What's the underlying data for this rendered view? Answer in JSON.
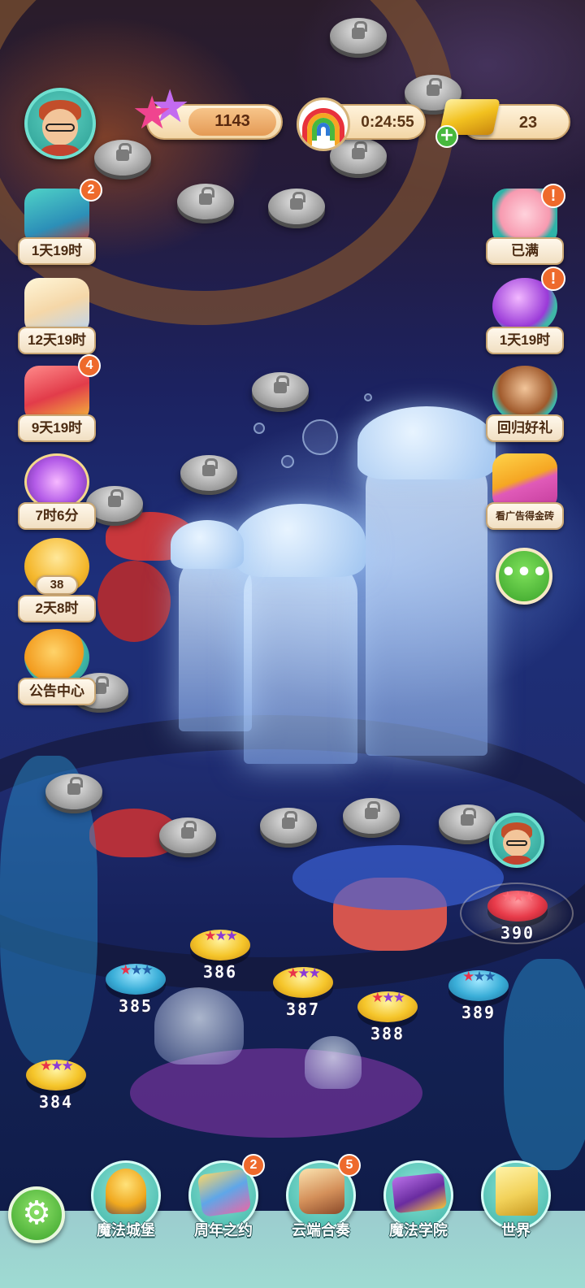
{
  "hud": {
    "stars": "1143",
    "timer": "0:24:55",
    "gold": "23",
    "gold_add_symbol": "+"
  },
  "left_events": [
    {
      "label": "1天19时",
      "badge": "2",
      "icon": "toy-train-icon"
    },
    {
      "label": "12天19时",
      "icon": "bow-dress-icon"
    },
    {
      "label": "9天19时",
      "badge": "4",
      "icon": "treasure-chest-icon"
    },
    {
      "label": "7时6分",
      "icon": "purple-star-icon"
    },
    {
      "label": "2天8时",
      "sub": "38",
      "icon": "paw-icon"
    },
    {
      "label": "公告中心",
      "icon": "megaphone-icon"
    }
  ],
  "right_events": [
    {
      "label": "已满",
      "badge": "!",
      "icon": "piggy-bank-icon"
    },
    {
      "label": "1天19时",
      "badge": "!",
      "icon": "crystal-ball-icon"
    },
    {
      "label": "回归好礼",
      "icon": "winking-boy-icon"
    },
    {
      "label": "看广告得金砖",
      "icon": "video-ad-icon"
    }
  ],
  "more_button": "•••",
  "levels": [
    {
      "num": "384",
      "type": "gold",
      "stars": [
        "red",
        "purple",
        "purple"
      ]
    },
    {
      "num": "385",
      "type": "blue",
      "stars": [
        "red",
        "blue",
        "blue"
      ]
    },
    {
      "num": "386",
      "type": "gold",
      "stars": [
        "red",
        "purple",
        "purple"
      ]
    },
    {
      "num": "387",
      "type": "gold",
      "stars": [
        "red",
        "purple",
        "purple"
      ]
    },
    {
      "num": "388",
      "type": "gold",
      "stars": [
        "red",
        "purple",
        "purple"
      ]
    },
    {
      "num": "389",
      "type": "blue",
      "stars": [
        "red",
        "blue",
        "blue"
      ]
    },
    {
      "num": "390",
      "type": "red",
      "stars": [
        "red",
        "red",
        "red"
      ]
    }
  ],
  "bottom_nav": [
    {
      "label": "魔法城堡",
      "icon": "lock-castle-icon"
    },
    {
      "label": "周年之约",
      "badge": "2",
      "icon": "anniversary-cards-icon"
    },
    {
      "label": "云端合奏",
      "badge": "5",
      "icon": "music-box-icon"
    },
    {
      "label": "魔法学院",
      "icon": "magic-book-icon"
    },
    {
      "label": "世界",
      "icon": "world-map-icon"
    }
  ],
  "settings_icon": "gear-icon",
  "colors": {
    "star_red": "#e8324a",
    "star_purple": "#8a3ad6",
    "star_blue": "#2461a8",
    "badge_orange": "#ee6a2c",
    "plus_green": "#48b83e"
  }
}
